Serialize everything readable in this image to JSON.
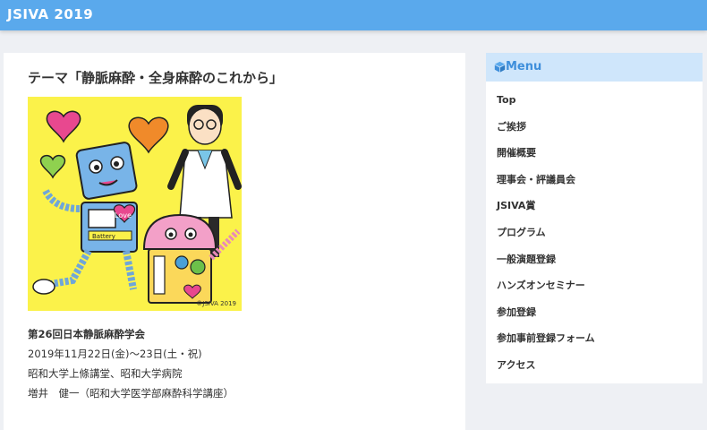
{
  "header": {
    "site_title": "JSIVA 2019"
  },
  "main": {
    "theme": "テーマ「静脈麻酔・全身麻酔のこれから」",
    "illustration": {
      "copyright": "©JSIVA 2019",
      "badge_text": "Love",
      "battery_text": "Battery"
    },
    "info": {
      "conference": "第26回日本静脈麻酔学会",
      "dates": "2019年11月22日(金)〜23日(土・祝)",
      "venue": "昭和大学上條講堂、昭和大学病院",
      "chair": "増井　健一（昭和大学医学部麻酔科学講座）"
    }
  },
  "sidebar": {
    "title": "Menu",
    "icon": "cube-icon",
    "items": [
      {
        "label": "Top"
      },
      {
        "label": "ご挨拶"
      },
      {
        "label": "開催概要"
      },
      {
        "label": "理事会・評議員会"
      },
      {
        "label": "JSIVA賞"
      },
      {
        "label": "プログラム"
      },
      {
        "label": "一般演題登録"
      },
      {
        "label": "ハンズオンセミナー"
      },
      {
        "label": "参加登録"
      },
      {
        "label": "参加事前登録フォーム"
      },
      {
        "label": "アクセス"
      }
    ]
  },
  "colors": {
    "header": "#5aa9ec",
    "menu_head": "#cfe6fb",
    "accent": "#3f8fdb",
    "illustration_bg": "#fbf24a"
  }
}
